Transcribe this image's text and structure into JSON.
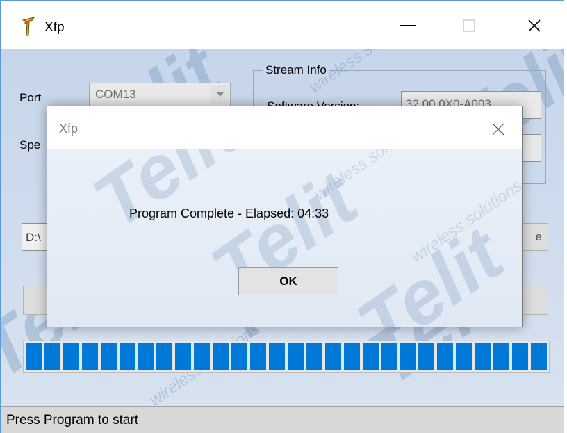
{
  "window": {
    "title": "Xfp",
    "controls": {
      "minimize": "—",
      "maximize": "☐",
      "close": "✕"
    }
  },
  "form": {
    "port_label": "Port",
    "port_value": "COM13",
    "speed_label": "Spe",
    "path_value": "D:\\",
    "right_button_partial": "e"
  },
  "stream_info": {
    "title": "Stream Info",
    "software_version_label": "Software Version:",
    "software_version_value": "32.00.0X0-A003"
  },
  "progress": {
    "percent": 100,
    "segments": 28
  },
  "status": {
    "text": "Press Program to start"
  },
  "dialog": {
    "title": "Xfp",
    "message": "Program Complete - Elapsed: 04:33",
    "ok_label": "OK"
  },
  "watermark": {
    "brand": "Telit",
    "tagline": "wireless solutions"
  },
  "colors": {
    "progress": "#0078d7",
    "accent": "#5b9bd5"
  }
}
